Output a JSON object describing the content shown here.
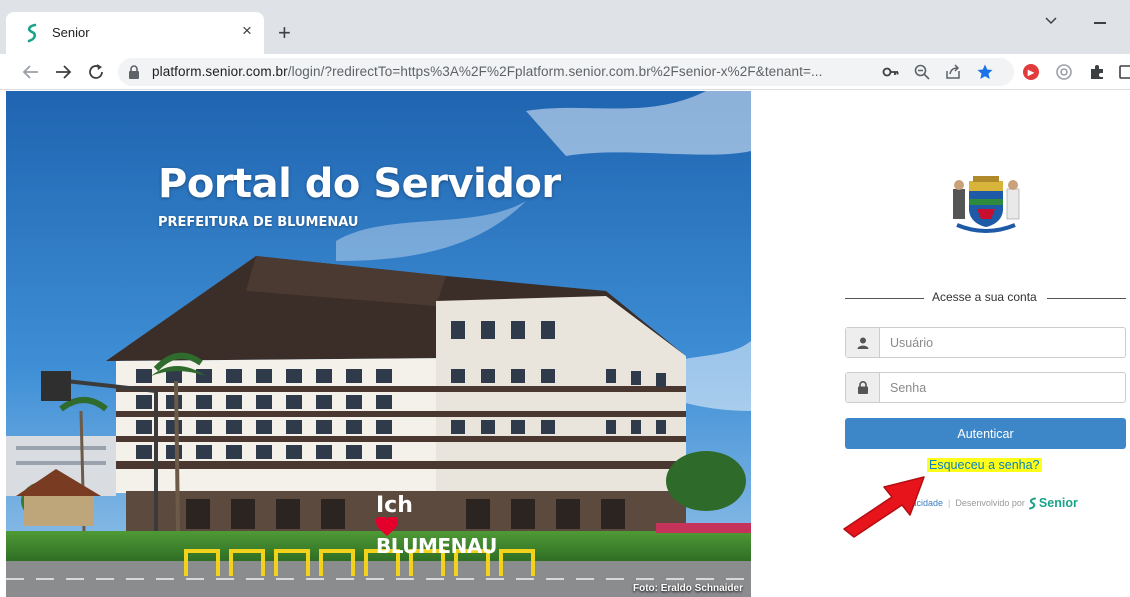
{
  "browser": {
    "tab_title": "Senior",
    "tab_close": "×",
    "new_tab": "+",
    "url_host": "platform.senior.com.br",
    "url_rest": "/login/?redirectTo=https%3A%2F%2Fplatform.senior.com.br%2Fsenior-x%2F&tenant=..."
  },
  "hero": {
    "title": "Portal do Servidor",
    "subtitle": "PREFEITURA DE BLUMENAU",
    "logo_word": "Ich",
    "logo_city": "BLUMENAU",
    "photo_credit": "Foto: Eraldo Schnaider"
  },
  "login": {
    "section_title": "Acesse a sua conta",
    "username_placeholder": "Usuário",
    "password_placeholder": "Senha",
    "submit_label": "Autenticar",
    "forgot_label": "Esqueceu a senha?",
    "footer_privacy": "Privacidade",
    "footer_sep": "|",
    "footer_developed": "Desenvolvido por",
    "footer_brand": "Senior"
  },
  "colors": {
    "primary_button": "#3d87c8",
    "highlight": "#ffff1a",
    "annotation_arrow": "#e8141c",
    "senior_brand": "#1aa38a"
  },
  "icons": [
    "senior-favicon-icon",
    "back-arrow-icon",
    "forward-arrow-icon",
    "reload-icon",
    "lock-icon",
    "key-icon",
    "zoom-icon",
    "share-icon",
    "bookmark-star-icon",
    "extension-icons",
    "user-icon",
    "padlock-icon"
  ]
}
